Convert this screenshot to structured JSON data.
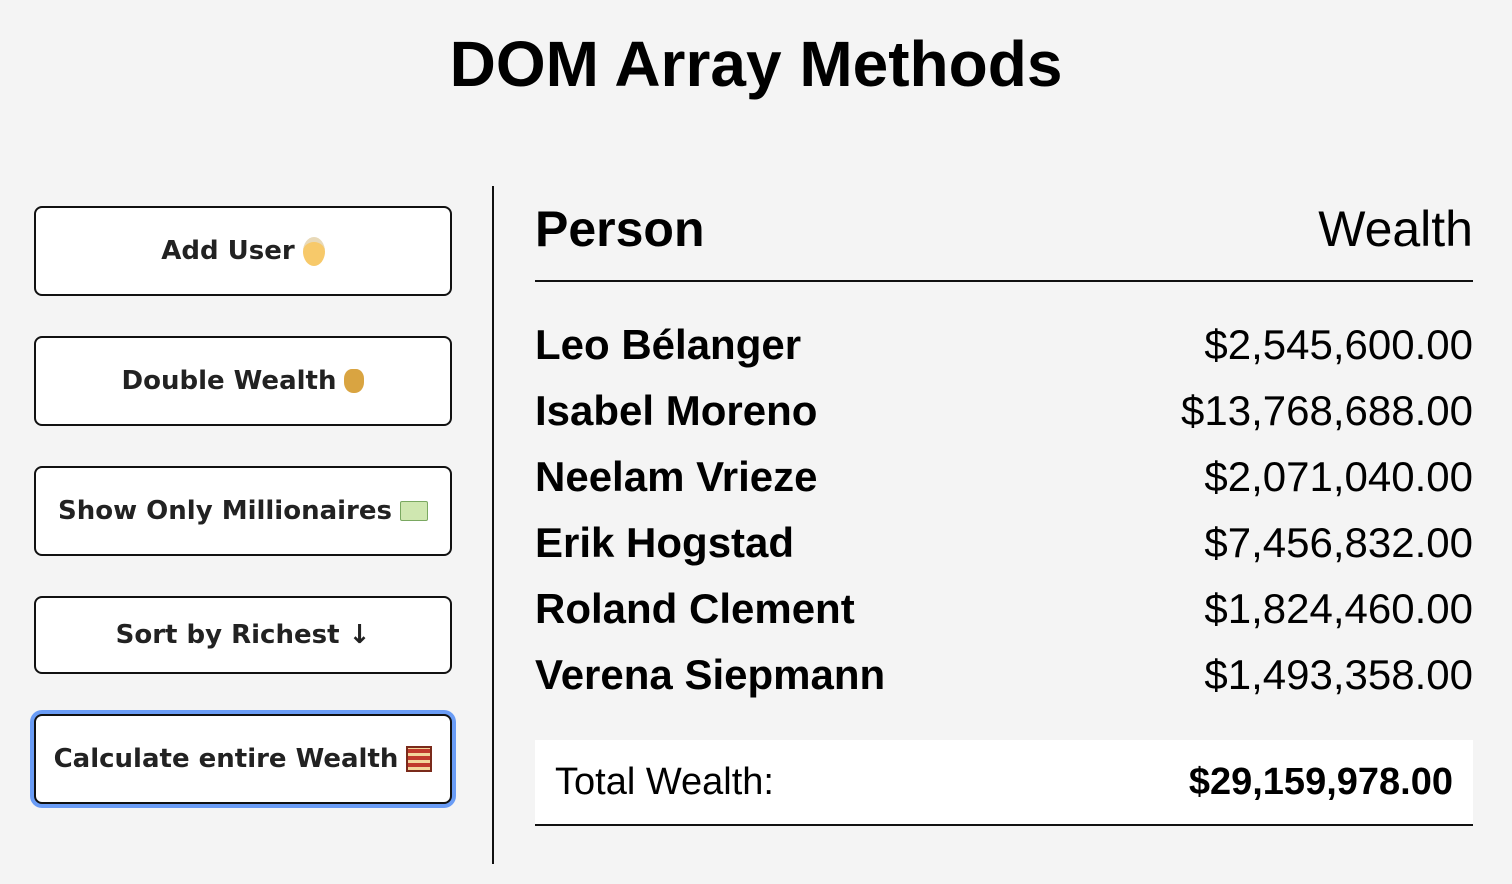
{
  "title": "DOM Array Methods",
  "buttons": {
    "add_user": "Add User",
    "double_wealth": "Double Wealth",
    "show_millionaires": "Show Only Millionaires",
    "sort_richest": "Sort by Richest ↓",
    "calculate_wealth": "Calculate entire Wealth"
  },
  "icons": {
    "add_user": "man-face-icon",
    "double_wealth": "money-bag-icon",
    "show_millionaires": "dollar-banknote-icon",
    "calculate_wealth": "abacus-icon"
  },
  "table": {
    "header_person": "Person",
    "header_wealth": "Wealth",
    "rows": [
      {
        "name": "Leo Bélanger",
        "wealth": "$2,545,600.00"
      },
      {
        "name": "Isabel Moreno",
        "wealth": "$13,768,688.00"
      },
      {
        "name": "Neelam Vrieze",
        "wealth": "$2,071,040.00"
      },
      {
        "name": "Erik Hogstad",
        "wealth": "$7,456,832.00"
      },
      {
        "name": "Roland Clement",
        "wealth": "$1,824,460.00"
      },
      {
        "name": "Verena Siepmann",
        "wealth": "$1,493,358.00"
      }
    ],
    "total_label": "Total Wealth:",
    "total_value": "$29,159,978.00"
  },
  "colors": {
    "background": "#f4f4f4",
    "focus_ring": "#6a9cf5"
  }
}
